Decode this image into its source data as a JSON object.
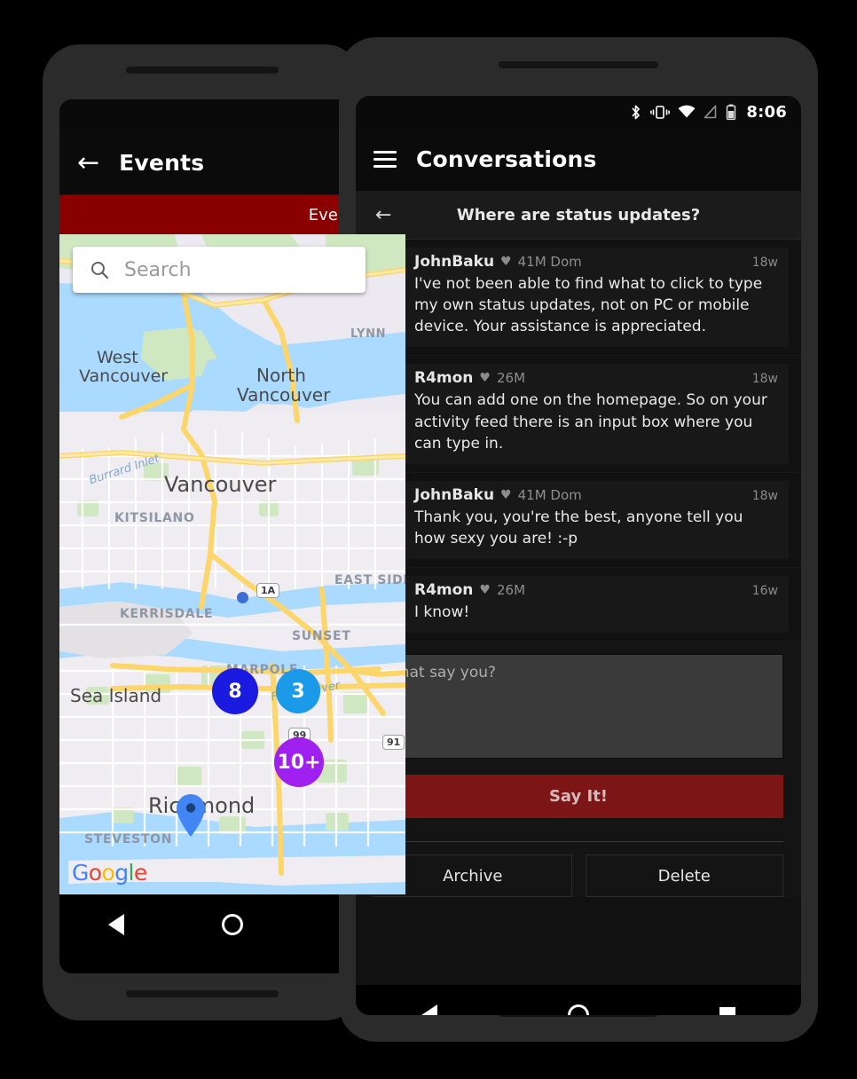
{
  "left_phone": {
    "appbar": {
      "back_icon": "arrow-left-icon",
      "title": "Events"
    },
    "tabbar": {
      "label": "Event Map",
      "color": "#8a0000"
    },
    "search": {
      "placeholder": "Search",
      "icon": "search-icon"
    },
    "map": {
      "attribution": "Google",
      "clusters": [
        {
          "label": "8",
          "color": "#1a1ae0",
          "size": 52
        },
        {
          "label": "3",
          "color": "#1a9ae8",
          "size": 50
        },
        {
          "label": "10+",
          "color": "#a020f0",
          "size": 56
        }
      ],
      "pins": [
        {
          "name": "pin-kerrisdale",
          "color": "#4285f4"
        },
        {
          "name": "pin-richmond",
          "color": "#4285f4"
        }
      ],
      "dots": [
        {
          "name": "dot-north-vancouver",
          "color": "#3b6fd4"
        }
      ],
      "labels": [
        {
          "text": "West",
          "type": "city"
        },
        {
          "text": "Vancouver",
          "type": "city"
        },
        {
          "text": "North",
          "type": "city"
        },
        {
          "text": "Vancouver",
          "type": "city"
        },
        {
          "text": "LYNN",
          "type": "nbhd"
        },
        {
          "text": "Burrard Inlet",
          "type": "water"
        },
        {
          "text": "Vancouver",
          "type": "city"
        },
        {
          "text": "KITSILANO",
          "type": "nbhd"
        },
        {
          "text": "EAST SIDE",
          "type": "nbhd"
        },
        {
          "text": "KERRISDALE",
          "type": "nbhd"
        },
        {
          "text": "SUNSET",
          "type": "nbhd"
        },
        {
          "text": "MARPOLE",
          "type": "nbhd"
        },
        {
          "text": "Sea Island",
          "type": "city"
        },
        {
          "text": "Fraser River",
          "type": "water"
        },
        {
          "text": "Richmond",
          "type": "city"
        },
        {
          "text": "STEVESTON",
          "type": "nbhd"
        }
      ],
      "highways": [
        "1A",
        "99",
        "91"
      ]
    },
    "navbar": {
      "back": "nav-back-icon",
      "home": "nav-home-icon"
    }
  },
  "right_phone": {
    "statusbar": {
      "bluetooth": "bluetooth-icon",
      "vibrate": "vibrate-icon",
      "wifi": "wifi-icon",
      "no_signal": "no-signal-icon",
      "battery": "battery-icon",
      "time": "8:06"
    },
    "appbar": {
      "menu_icon": "hamburger-icon",
      "title": "Conversations"
    },
    "thread": {
      "back_icon": "arrow-left-icon",
      "subject": "Where are status updates?",
      "messages": [
        {
          "author": "JohnBaku",
          "gender_icon": "heart-icon",
          "meta": "41M Dom",
          "time": "18w",
          "text": "I've not been able to find what to click to type my own status updates, not on PC or mobile device. Your assistance is appreciated.",
          "avatar_colors": [
            "#9a87b8",
            "#5a4c6e",
            "#cbb8d6"
          ]
        },
        {
          "author": "R4mon",
          "gender_icon": "heart-icon",
          "meta": "26M",
          "time": "18w",
          "text": "You can add one on the homepage. So on your activity feed there is an input box where you can type in.",
          "avatar_colors": [
            "#a8c4d8",
            "#2b2b33",
            "#d9c9b0"
          ]
        },
        {
          "author": "JohnBaku",
          "gender_icon": "heart-icon",
          "meta": "41M Dom",
          "time": "18w",
          "text": "Thank you, you're the best, anyone tell you how sexy you are! :-p",
          "avatar_colors": [
            "#9a87b8",
            "#5a4c6e",
            "#cbb8d6"
          ]
        },
        {
          "author": "R4mon",
          "gender_icon": "heart-icon",
          "meta": "26M",
          "time": "16w",
          "text": "I know!",
          "avatar_colors": [
            "#a8c4d8",
            "#2b2b33",
            "#d9c9b0"
          ]
        }
      ]
    },
    "compose": {
      "placeholder": "What say you?",
      "value": "",
      "submit_label": "Say It!",
      "submit_color": "#7c1616"
    },
    "actions": [
      {
        "label": "Archive",
        "name": "archive-button"
      },
      {
        "label": "Delete",
        "name": "delete-button"
      }
    ],
    "navbar": {
      "back": "nav-back-icon",
      "home": "nav-home-icon",
      "recents": "nav-recents-icon"
    }
  }
}
